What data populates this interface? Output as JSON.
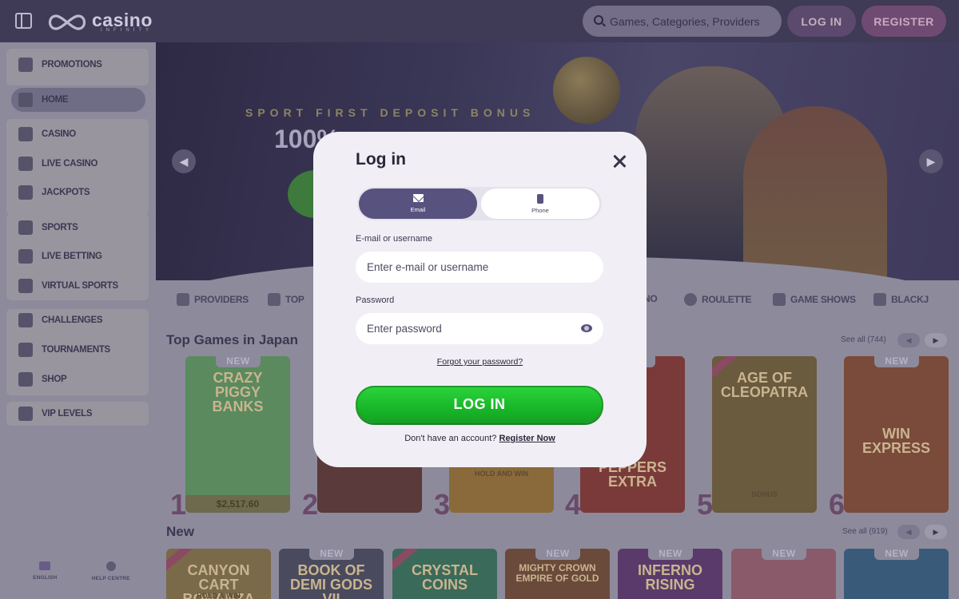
{
  "header": {
    "logo_text": "casino",
    "logo_sub": "INFINITY",
    "search_placeholder": "Games, Categories, Providers",
    "login_label": "LOG IN",
    "register_label": "REGISTER"
  },
  "sidebar": {
    "items": [
      {
        "label": "PROMOTIONS",
        "icon": "gift-icon"
      },
      {
        "label": "HOME",
        "icon": "home-icon"
      },
      {
        "label": "CASINO",
        "icon": "casino-icon"
      },
      {
        "label": "LIVE CASINO",
        "icon": "live-casino-icon"
      },
      {
        "label": "JACKPOTS",
        "icon": "jackpot-icon"
      },
      {
        "label": "SPORTS",
        "icon": "sports-icon"
      },
      {
        "label": "LIVE BETTING",
        "icon": "live-betting-icon"
      },
      {
        "label": "VIRTUAL SPORTS",
        "icon": "virtual-sports-icon"
      },
      {
        "label": "CHALLENGES",
        "icon": "challenges-icon"
      },
      {
        "label": "TOURNAMENTS",
        "icon": "trophy-icon"
      },
      {
        "label": "SHOP",
        "icon": "shop-icon"
      },
      {
        "label": "VIP LEVELS",
        "icon": "star-icon"
      }
    ],
    "language_label": "ENGLISH",
    "help_label": "HELP CENTRE"
  },
  "banner": {
    "kicker": "SPORT FIRST DEPOSIT BONUS",
    "headline": "100%"
  },
  "categories": [
    {
      "label": "PROVIDERS"
    },
    {
      "label": "TOP"
    },
    {
      "label": "NO"
    },
    {
      "label": "ROULETTE"
    },
    {
      "label": "GAME SHOWS"
    },
    {
      "label": "BLACKJ"
    }
  ],
  "top_games": {
    "title": "Top Games in Japan",
    "see_all": "See all (744)",
    "cards": [
      {
        "rank": "1",
        "title": "CRAZY PIGGY BANKS",
        "badge": "NEW",
        "jackpot": "$2,517.60",
        "color": "#5a8a5e"
      },
      {
        "rank": "2",
        "title": "",
        "badge": "",
        "jackpot": "",
        "color": "#5a3a3a"
      },
      {
        "rank": "3",
        "title": "",
        "sub": "HOLD AND WIN",
        "badge": "",
        "jackpot": "",
        "color": "#8a6a3a"
      },
      {
        "rank": "4",
        "title": "PEPPERS EXTRA",
        "badge": "NEW",
        "jackpot": "",
        "color": "#7a3a3a"
      },
      {
        "rank": "5",
        "title": "AGE OF CLEOPATRA",
        "sub": "BONUS",
        "badge": "",
        "jackpot": "",
        "color": "#6a5a3e"
      },
      {
        "rank": "6",
        "title": "WIN EXPRESS",
        "badge": "NEW",
        "jackpot": "",
        "color": "#7a4a3a"
      }
    ]
  },
  "new_games": {
    "title": "New",
    "see_all": "See all (919)",
    "cards": [
      {
        "title": "CANYON CART BONANZA",
        "sub": "HOLD & WIN",
        "badge": "",
        "color": "#7a6a4a"
      },
      {
        "title": "BOOK OF DEMI GODS VII",
        "badge": "NEW",
        "color": "#4a4a5e"
      },
      {
        "title": "CRYSTAL COINS",
        "badge": "",
        "color": "#3a6a5a"
      },
      {
        "title": "MIGHTY CROWN EMPIRE OF GOLD",
        "badge": "NEW",
        "color": "#6a4a3a"
      },
      {
        "title": "INFERNO RISING",
        "badge": "NEW",
        "color": "#5a3a6a"
      },
      {
        "title": "",
        "badge": "NEW",
        "color": "#8a5a6a"
      },
      {
        "title": "",
        "badge": "NEW",
        "color": "#3a5a7a"
      }
    ]
  },
  "modal": {
    "title": "Log in",
    "tab_email": "Email",
    "tab_phone": "Phone",
    "email_label": "E-mail or username",
    "email_placeholder": "Enter e-mail or username",
    "password_label": "Password",
    "password_placeholder": "Enter password",
    "forgot": "Forgot your password?",
    "submit": "LOG IN",
    "no_account": "Don't have an account?",
    "register_link": "Register Now"
  },
  "colors": {
    "accent": "#58527f",
    "login_green": "#19b729",
    "modal_bg": "#f1eff5"
  }
}
